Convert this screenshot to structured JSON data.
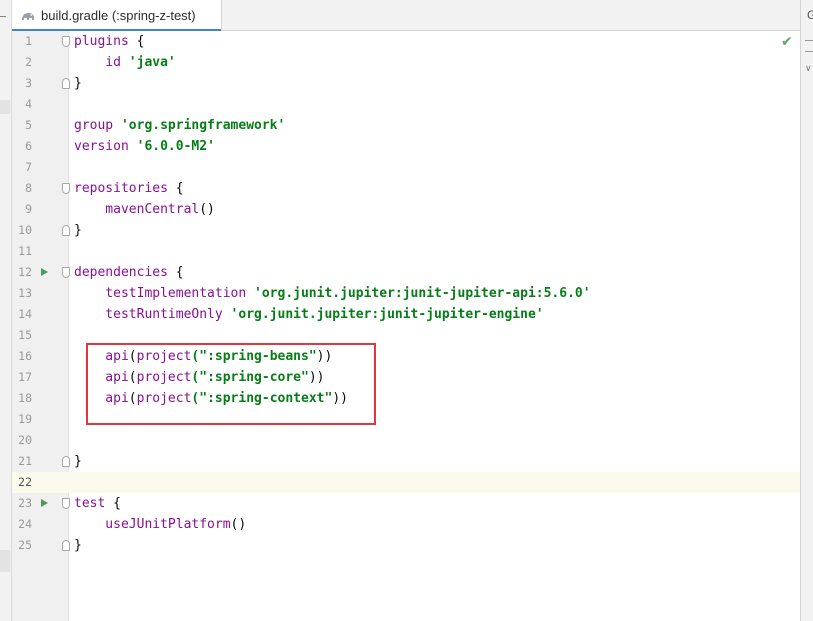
{
  "tab": {
    "label": "build.gradle (:spring-z-test)",
    "icon": "gradle-elephant-icon"
  },
  "right_panel": {
    "letter": "G"
  },
  "colors": {
    "keyword": "#871094",
    "function": "#00627a",
    "string": "#067d17",
    "highlight_border": "#e0383e",
    "current_line": "#fcfaed",
    "run_icon": "#499c54"
  },
  "lines": [
    {
      "n": "1",
      "a": "plugins",
      "b": " {",
      "c": "",
      "d": "",
      "e": ""
    },
    {
      "n": "2",
      "a": "    id ",
      "b": "'java'",
      "c": "",
      "d": "",
      "e": ""
    },
    {
      "n": "3",
      "a": "}",
      "b": "",
      "c": "",
      "d": "",
      "e": ""
    },
    {
      "n": "4",
      "a": "",
      "b": "",
      "c": "",
      "d": "",
      "e": ""
    },
    {
      "n": "5",
      "a": "group ",
      "b": "'org.springframework'",
      "c": "",
      "d": "",
      "e": ""
    },
    {
      "n": "6",
      "a": "version ",
      "b": "'6.0.0-M2'",
      "c": "",
      "d": "",
      "e": ""
    },
    {
      "n": "7",
      "a": "",
      "b": "",
      "c": "",
      "d": "",
      "e": ""
    },
    {
      "n": "8",
      "a": "repositories",
      "b": " {",
      "c": "",
      "d": "",
      "e": ""
    },
    {
      "n": "9",
      "a": "    mavenCentral",
      "b": "()",
      "c": "",
      "d": "",
      "e": ""
    },
    {
      "n": "10",
      "a": "}",
      "b": "",
      "c": "",
      "d": "",
      "e": ""
    },
    {
      "n": "11",
      "a": "",
      "b": "",
      "c": "",
      "d": "",
      "e": ""
    },
    {
      "n": "12",
      "a": "dependencies",
      "b": " {",
      "c": "",
      "d": "",
      "e": ""
    },
    {
      "n": "13",
      "a": "    testImplementation ",
      "b": "'org.junit.jupiter:junit-jupiter-api:5.6.0'",
      "c": "",
      "d": "",
      "e": ""
    },
    {
      "n": "14",
      "a": "    testRuntimeOnly ",
      "b": "'org.junit.jupiter:junit-jupiter-engine'",
      "c": "",
      "d": "",
      "e": ""
    },
    {
      "n": "15",
      "a": "",
      "b": "",
      "c": "",
      "d": "",
      "e": ""
    },
    {
      "n": "16",
      "a": "    api",
      "b": "(",
      "c": "project",
      "d": "(\":spring-beans\"",
      "e": "))"
    },
    {
      "n": "17",
      "a": "    api",
      "b": "(",
      "c": "project",
      "d": "(\":spring-core\"",
      "e": "))"
    },
    {
      "n": "18",
      "a": "    api",
      "b": "(",
      "c": "project",
      "d": "(\":spring-context\"",
      "e": "))"
    },
    {
      "n": "19",
      "a": "",
      "b": "",
      "c": "",
      "d": "",
      "e": ""
    },
    {
      "n": "20",
      "a": "",
      "b": "",
      "c": "",
      "d": "",
      "e": ""
    },
    {
      "n": "21",
      "a": "}",
      "b": "",
      "c": "",
      "d": "",
      "e": ""
    },
    {
      "n": "22",
      "a": "",
      "b": "",
      "c": "",
      "d": "",
      "e": ""
    },
    {
      "n": "23",
      "a": "test",
      "b": " {",
      "c": "",
      "d": "",
      "e": ""
    },
    {
      "n": "24",
      "a": "    useJUnitPlatform",
      "b": "()",
      "c": "",
      "d": "",
      "e": ""
    },
    {
      "n": "25",
      "a": "}",
      "b": "",
      "c": "",
      "d": "",
      "e": ""
    }
  ]
}
